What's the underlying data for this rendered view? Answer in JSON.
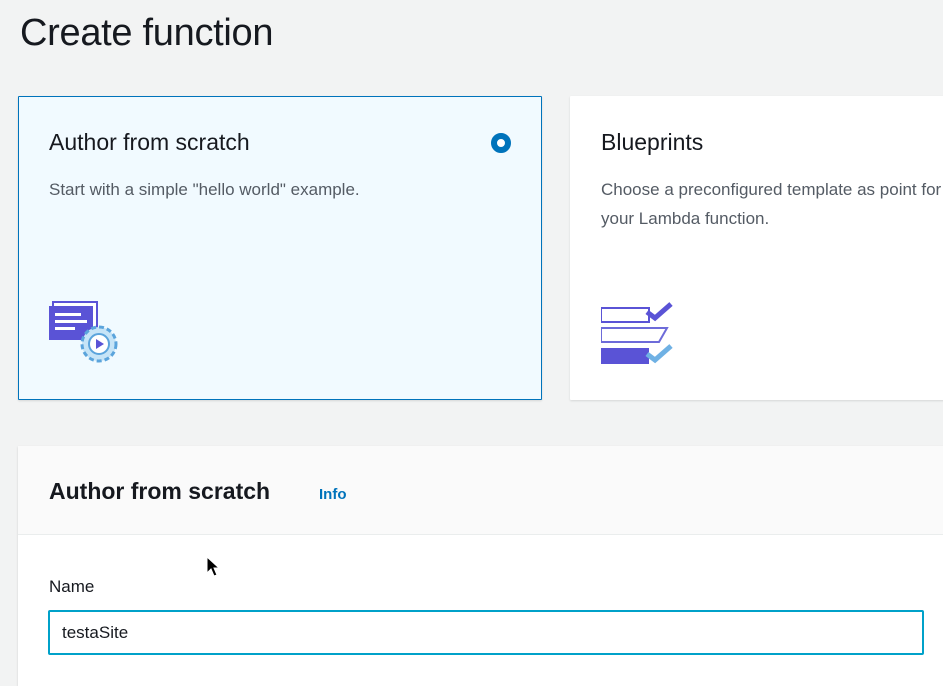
{
  "page": {
    "title": "Create function"
  },
  "options": [
    {
      "title": "Author from scratch",
      "description": "Start with a simple \"hello world\" example.",
      "selected": true,
      "icon": "code-gear-icon"
    },
    {
      "title": "Blueprints",
      "description": "Choose a preconfigured template as point for your Lambda function.",
      "selected": false,
      "icon": "checklist-icon"
    }
  ],
  "panel": {
    "title": "Author from scratch",
    "info_label": "Info",
    "name_label": "Name",
    "name_value": "testaSite"
  },
  "colors": {
    "accent": "#0073bb",
    "selected_bg": "#f1faff",
    "input_focus": "#00a1c9",
    "icon_purple": "#5a53d6"
  }
}
